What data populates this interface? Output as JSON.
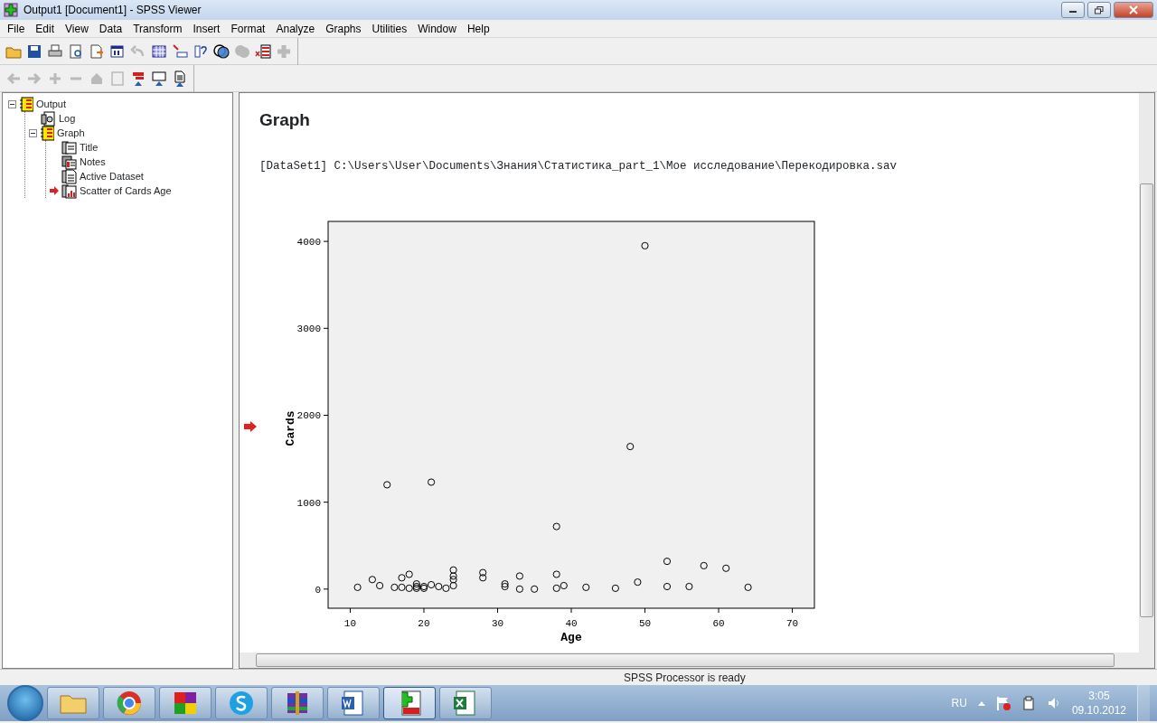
{
  "window": {
    "title": "Output1 [Document1] - SPSS Viewer"
  },
  "menu": [
    "File",
    "Edit",
    "View",
    "Data",
    "Transform",
    "Insert",
    "Format",
    "Analyze",
    "Graphs",
    "Utilities",
    "Window",
    "Help"
  ],
  "toolbar": [
    {
      "disabled": false
    },
    {
      "disabled": false
    },
    {
      "disabled": false
    },
    {
      "disabled": false
    },
    {
      "disabled": false
    },
    {
      "disabled": false
    },
    {
      "disabled": true
    },
    {
      "disabled": false
    },
    {
      "disabled": false
    },
    {
      "disabled": false
    },
    {
      "disabled": false
    },
    {
      "disabled": true
    },
    {
      "disabled": false
    },
    {
      "disabled": true
    }
  ],
  "outline_toolbar": [
    {
      "disabled": true
    },
    {
      "disabled": true
    },
    {
      "disabled": true
    },
    {
      "disabled": true
    },
    {
      "disabled": true
    },
    {
      "disabled": true
    },
    {
      "disabled": false
    },
    {
      "disabled": false
    },
    {
      "disabled": false
    }
  ],
  "outline": [
    {
      "label": "Output",
      "selected": false,
      "expanded": true,
      "children": [
        {
          "label": "Log",
          "selected": false
        },
        {
          "label": "Graph",
          "selected": false,
          "expanded": true,
          "children": [
            {
              "label": "Title",
              "selected": false
            },
            {
              "label": "Notes",
              "selected": false
            },
            {
              "label": "Active Dataset",
              "selected": false
            },
            {
              "label": "Scatter of Cards Age",
              "selected": true
            }
          ]
        }
      ]
    }
  ],
  "content": {
    "heading": "Graph",
    "dataset_path": "[DataSet1] C:\\Users\\User\\Documents\\Знания\\Статистика_part_1\\Мое исследование\\Перекодировка.sav",
    "chart_data": {
      "type": "scatter",
      "xlabel": "Age",
      "ylabel": "Cards",
      "xlim": [
        7,
        73
      ],
      "ylim": [
        -220,
        4230
      ],
      "xticks": [
        10,
        20,
        30,
        40,
        50,
        60,
        70
      ],
      "yticks": [
        0,
        1000,
        2000,
        3000,
        4000
      ],
      "x": [
        11,
        13,
        14,
        15,
        16,
        17,
        17,
        18,
        18,
        19,
        19,
        19,
        20,
        20,
        21,
        21,
        22,
        23,
        24,
        24,
        24,
        24,
        28,
        28,
        31,
        31,
        33,
        33,
        35,
        38,
        38,
        38,
        39,
        42,
        46,
        48,
        49,
        50,
        53,
        53,
        56,
        58,
        61,
        64
      ],
      "series": [
        {
          "color": "#000000",
          "values": [
            20,
            110,
            40,
            1200,
            20,
            20,
            130,
            170,
            10,
            60,
            30,
            10,
            30,
            10,
            50,
            1230,
            30,
            10,
            220,
            150,
            110,
            40,
            190,
            130,
            60,
            30,
            150,
            0,
            0,
            720,
            170,
            10,
            40,
            20,
            10,
            1640,
            80,
            3950,
            320,
            30,
            30,
            270,
            240,
            20
          ]
        }
      ]
    }
  },
  "status_bar": "SPSS Processor is ready",
  "taskbar": {
    "apps": [
      {
        "active": false
      },
      {
        "active": false
      },
      {
        "active": false
      },
      {
        "active": false
      },
      {
        "active": false
      },
      {
        "active": false
      },
      {
        "active": true
      },
      {
        "active": false
      }
    ],
    "language": "RU",
    "time": "3:05",
    "date": "09.10.2012"
  }
}
